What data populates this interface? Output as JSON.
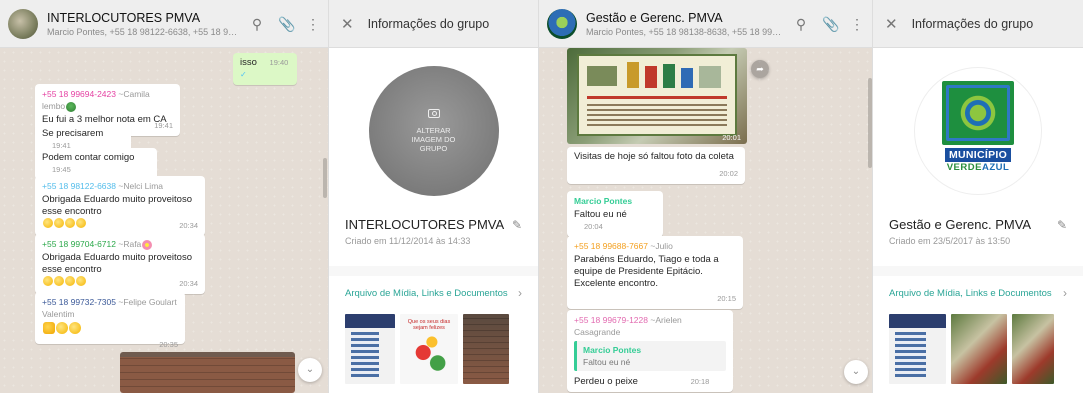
{
  "chat1": {
    "title": "INTERLOCUTORES PMVA",
    "subtitle": "Marcio Pontes, +55 18 98122-6638, +55 18 98151-3392, +55 ...",
    "icons": [
      "search-icon",
      "attach-icon",
      "menu-icon"
    ],
    "messages": [
      {
        "dir": "out",
        "text": "isso",
        "time": "19:40"
      },
      {
        "number": "+55 18 99694-2423",
        "name": "~Camila lembo",
        "text": "Eu fui a 3 melhor nota em CA",
        "time": "19:41"
      },
      {
        "text": "Se precisarem",
        "time": "19:41"
      },
      {
        "text": "Podem contar comigo",
        "time": "19:45"
      },
      {
        "number": "+55 18 98122-6638",
        "name": "~Nelci Lima",
        "text": "Obrigada Eduardo muito proveitoso esse encontro",
        "time": "20:34"
      },
      {
        "number": "+55 18 99704-6712",
        "name": "~Rafa",
        "text": "Obrigada Eduardo muito proveitoso esse encontro",
        "time": "20:34"
      },
      {
        "number": "+55 18 99732-7305",
        "name": "~Felipe Goulart Valentim",
        "text": "",
        "time": "20:35"
      }
    ]
  },
  "info1": {
    "close_icon": "close-icon",
    "header": "Informações do grupo",
    "photo_label": "ALTERAR IMAGEM DO GRUPO",
    "group_name": "INTERLOCUTORES PMVA",
    "created": "Criado em 11/12/2014 às 14:33",
    "media_label": "Arquivo de Mídia, Links e Documentos",
    "thumb_caption": "Que os seus dias sejam felizes"
  },
  "chat2": {
    "title": "Gestão e Gerenc. PMVA",
    "subtitle": "Marcio Pontes, +55 18 98138-8638, +55 18 99604-9679, +55 ...",
    "messages": [
      {
        "kind": "image",
        "time": "20:01"
      },
      {
        "text": "Visitas de hoje só faltou foto da coleta",
        "time": "20:02"
      },
      {
        "sender": "Marcio Pontes",
        "text": "Faltou eu né",
        "time": "20:04"
      },
      {
        "number": "+55 18 99688-7667",
        "name": "~Julio",
        "text": "Parabéns Eduardo, Tiago e toda a equipe de Presidente Epitácio. Excelente encontro.",
        "time": "20:15"
      },
      {
        "number": "+55 18 99679-1228",
        "name": "~Arielen Casagrande",
        "quote_sender": "Marcio Pontes",
        "quote_text": "Faltou eu né",
        "text": "Perdeu o peixe",
        "time": "20:18"
      }
    ]
  },
  "info2": {
    "header": "Informações do grupo",
    "logo_line1": "MUNICÍPIO",
    "logo_line2a": "VERDE",
    "logo_line2b": "AZUL",
    "group_name": "Gestão e Gerenc. PMVA",
    "created": "Criado em 23/5/2017 às 13:50",
    "media_label": "Arquivo de Mídia, Links e Documentos"
  },
  "colors": {
    "outgoing_bubble": "#dcf8c6",
    "media_link": "#2aa596",
    "chat_bg": "#e5ddd5"
  }
}
